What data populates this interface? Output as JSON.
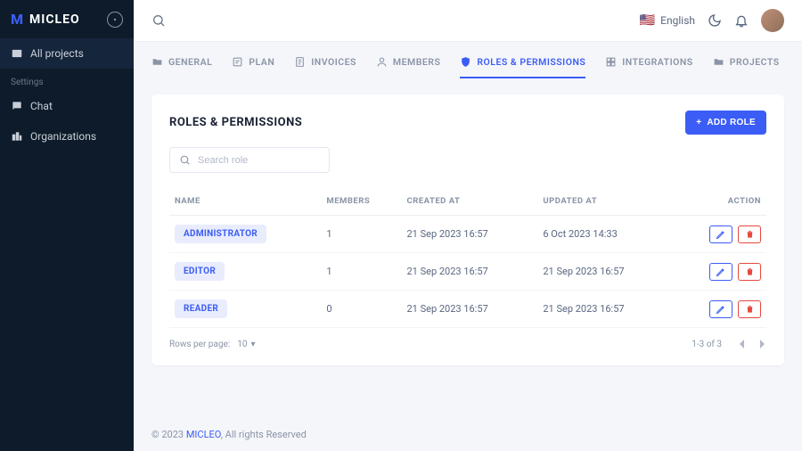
{
  "brand": {
    "name": "MICLEO"
  },
  "sidebar": {
    "items": [
      {
        "label": "All projects"
      }
    ],
    "sectionTitle": "Settings",
    "settingsItems": [
      {
        "label": "Chat"
      },
      {
        "label": "Organizations"
      }
    ]
  },
  "topbar": {
    "language": "English"
  },
  "tabs": [
    {
      "label": "GENERAL"
    },
    {
      "label": "PLAN"
    },
    {
      "label": "INVOICES"
    },
    {
      "label": "MEMBERS"
    },
    {
      "label": "ROLES & PERMISSIONS"
    },
    {
      "label": "INTEGRATIONS"
    },
    {
      "label": "PROJECTS"
    }
  ],
  "panel": {
    "title": "ROLES & PERMISSIONS",
    "addLabel": "ADD ROLE",
    "searchPlaceholder": "Search role"
  },
  "table": {
    "headers": {
      "name": "NAME",
      "members": "MEMBERS",
      "created": "CREATED AT",
      "updated": "UPDATED AT",
      "action": "ACTION"
    },
    "rows": [
      {
        "name": "ADMINISTRATOR",
        "members": "1",
        "created": "21 Sep 2023 16:57",
        "updated": "6 Oct 2023 14:33"
      },
      {
        "name": "EDITOR",
        "members": "1",
        "created": "21 Sep 2023 16:57",
        "updated": "21 Sep 2023 16:57"
      },
      {
        "name": "READER",
        "members": "0",
        "created": "21 Sep 2023 16:57",
        "updated": "21 Sep 2023 16:57"
      }
    ]
  },
  "pagination": {
    "rppLabel": "Rows per page:",
    "rppValue": "10",
    "range": "1-3 of 3"
  },
  "footer": {
    "prefix": "© 2023 ",
    "brand": "MICLEO",
    "suffix": ", All rights Reserved"
  }
}
